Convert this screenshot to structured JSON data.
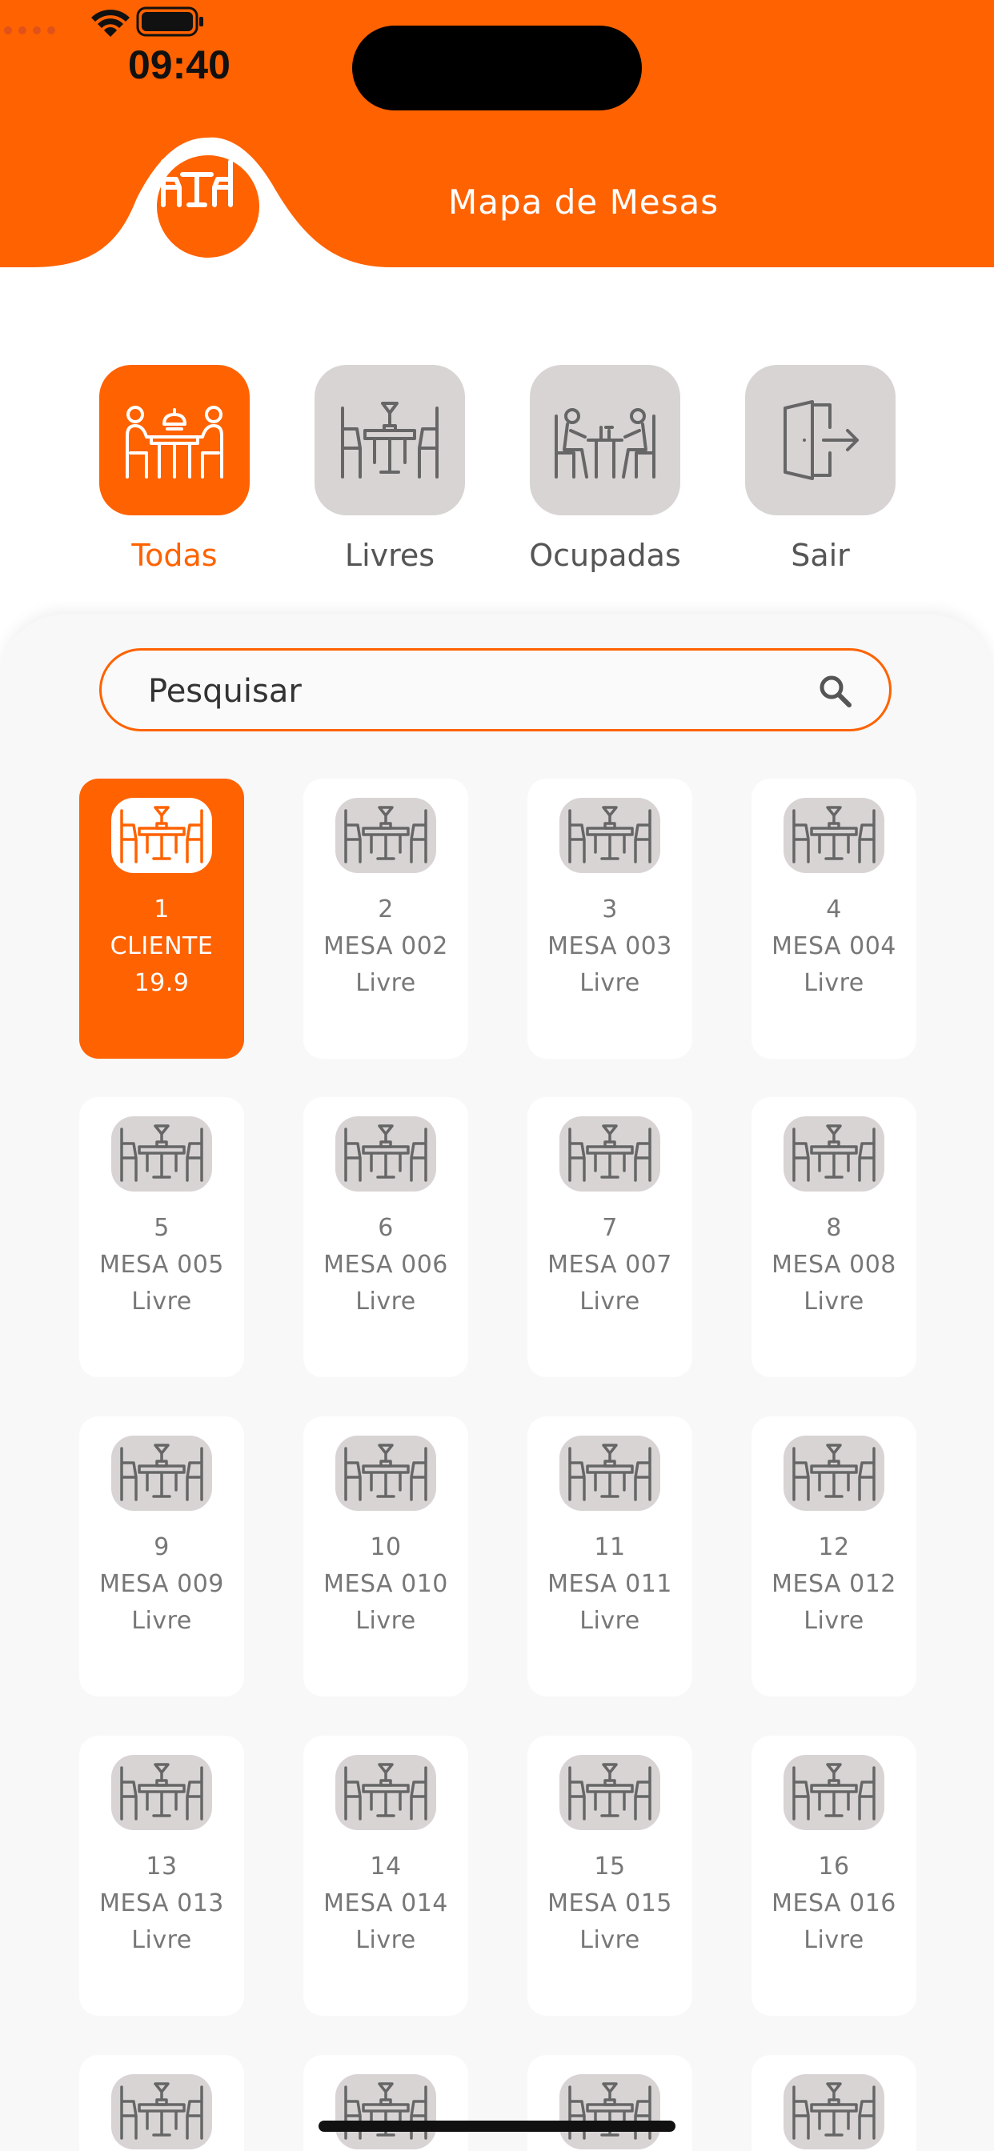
{
  "status_bar": {
    "time": "09:40"
  },
  "header": {
    "title": "Mapa de Mesas"
  },
  "colors": {
    "accent": "#ff6200",
    "tile_inactive": "#d9d4d4",
    "panel_bg": "#f8f8f8"
  },
  "filters": [
    {
      "label": "Todas",
      "icon": "people-dining-icon",
      "active": true
    },
    {
      "label": "Livres",
      "icon": "empty-table-icon",
      "active": false
    },
    {
      "label": "Ocupadas",
      "icon": "occupied-table-icon",
      "active": false
    },
    {
      "label": "Sair",
      "icon": "logout-door-icon",
      "active": false
    }
  ],
  "search": {
    "placeholder": "Pesquisar"
  },
  "tables": [
    {
      "number": "1",
      "name": "CLIENTE",
      "status": "19.9",
      "active": true
    },
    {
      "number": "2",
      "name": "MESA 002",
      "status": "Livre"
    },
    {
      "number": "3",
      "name": "MESA 003",
      "status": "Livre"
    },
    {
      "number": "4",
      "name": "MESA 004",
      "status": "Livre"
    },
    {
      "number": "5",
      "name": "MESA 005",
      "status": "Livre"
    },
    {
      "number": "6",
      "name": "MESA 006",
      "status": "Livre"
    },
    {
      "number": "7",
      "name": "MESA 007",
      "status": "Livre"
    },
    {
      "number": "8",
      "name": "MESA 008",
      "status": "Livre"
    },
    {
      "number": "9",
      "name": "MESA 009",
      "status": "Livre"
    },
    {
      "number": "10",
      "name": "MESA 010",
      "status": "Livre"
    },
    {
      "number": "11",
      "name": "MESA 011",
      "status": "Livre"
    },
    {
      "number": "12",
      "name": "MESA 012",
      "status": "Livre"
    },
    {
      "number": "13",
      "name": "MESA 013",
      "status": "Livre"
    },
    {
      "number": "14",
      "name": "MESA 014",
      "status": "Livre"
    },
    {
      "number": "15",
      "name": "MESA 015",
      "status": "Livre"
    },
    {
      "number": "16",
      "name": "MESA 016",
      "status": "Livre"
    },
    {
      "number": "",
      "name": "",
      "status": ""
    },
    {
      "number": "",
      "name": "",
      "status": ""
    },
    {
      "number": "",
      "name": "",
      "status": ""
    },
    {
      "number": "",
      "name": "",
      "status": ""
    }
  ]
}
